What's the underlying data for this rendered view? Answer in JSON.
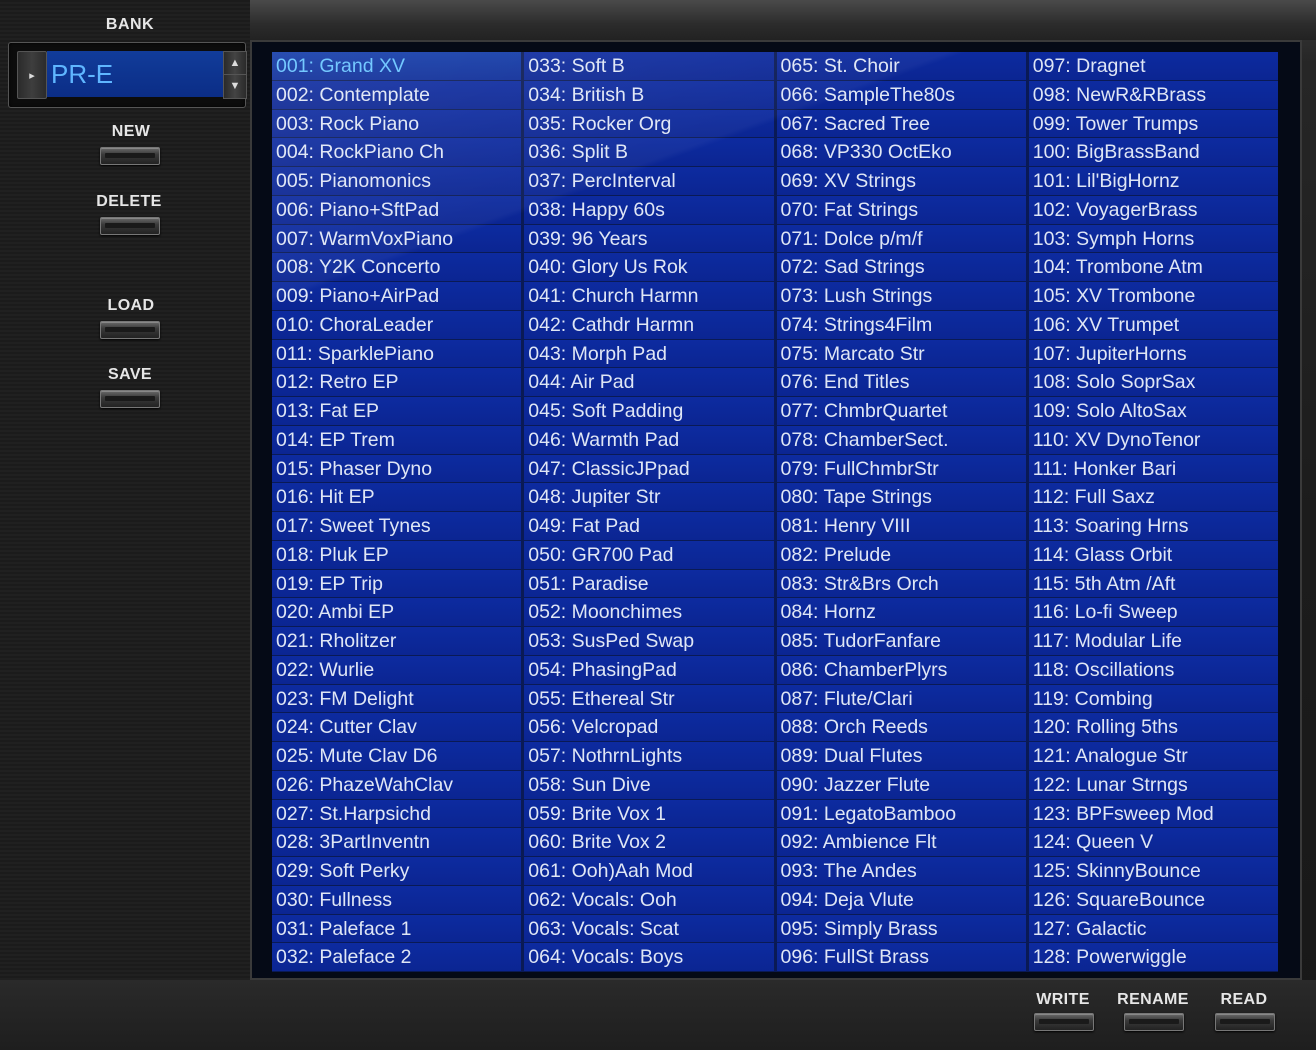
{
  "bank": {
    "label": "BANK",
    "value": "PR-E",
    "arrow_icon": "play-arrow-icon",
    "spin_up_icon": "triangle-up-icon",
    "spin_down_icon": "triangle-down-icon"
  },
  "side_buttons": {
    "new_label": "NEW",
    "delete_label": "DELETE",
    "load_label": "LOAD",
    "save_label": "SAVE"
  },
  "bottom_buttons": {
    "write_label": "WRITE",
    "rename_label": "RENAME",
    "read_label": "READ"
  },
  "colors": {
    "cell_bg": "#0b2592",
    "selected_text": "#66c3ff",
    "text": "#dfe6f5"
  },
  "patch_list": {
    "selected_index": 0,
    "columns": [
      [
        "001: Grand XV",
        "002: Contemplate",
        "003: Rock Piano",
        "004: RockPiano Ch",
        "005: Pianomonics",
        "006: Piano+SftPad",
        "007: WarmVoxPiano",
        "008: Y2K Concerto",
        "009: Piano+AirPad",
        "010: ChoraLeader",
        "011: SparklePiano",
        "012: Retro EP",
        "013: Fat EP",
        "014: EP Trem",
        "015: Phaser Dyno",
        "016: Hit EP",
        "017: Sweet Tynes",
        "018: Pluk EP",
        "019: EP Trip",
        "020: Ambi EP",
        "021: Rholitzer",
        "022: Wurlie",
        "023: FM Delight",
        "024: Cutter Clav",
        "025: Mute Clav D6",
        "026: PhazeWahClav",
        "027: St.Harpsichd",
        "028: 3PartInventn",
        "029: Soft Perky",
        "030: Fullness",
        "031: Paleface 1",
        "032: Paleface 2"
      ],
      [
        "033: Soft B",
        "034: British B",
        "035: Rocker Org",
        "036: Split B",
        "037: PercInterval",
        "038: Happy 60s",
        "039: 96 Years",
        "040: Glory Us Rok",
        "041: Church Harmn",
        "042: Cathdr Harmn",
        "043: Morph Pad",
        "044: Air Pad",
        "045: Soft Padding",
        "046: Warmth Pad",
        "047: ClassicJPpad",
        "048: Jupiter Str",
        "049: Fat Pad",
        "050: GR700 Pad",
        "051: Paradise",
        "052: Moonchimes",
        "053: SusPed Swap",
        "054: PhasingPad",
        "055: Ethereal Str",
        "056: Velcropad",
        "057: NothrnLights",
        "058: Sun Dive",
        "059: Brite Vox 1",
        "060: Brite Vox 2",
        "061: Ooh)Aah Mod",
        "062: Vocals: Ooh",
        "063: Vocals: Scat",
        "064: Vocals: Boys"
      ],
      [
        "065: St. Choir",
        "066: SampleThe80s",
        "067: Sacred Tree",
        "068: VP330 OctEko",
        "069: XV Strings",
        "070: Fat Strings",
        "071: Dolce  p/m/f",
        "072: Sad Strings",
        "073: Lush Strings",
        "074: Strings4Film",
        "075: Marcato Str",
        "076: End Titles",
        "077: ChmbrQuartet",
        "078: ChamberSect.",
        "079: FullChmbrStr",
        "080: Tape Strings",
        "081: Henry VIII",
        "082: Prelude",
        "083: Str&Brs Orch",
        "084: Hornz",
        "085: TudorFanfare",
        "086: ChamberPlyrs",
        "087: Flute/Clari",
        "088: Orch Reeds",
        "089: Dual Flutes",
        "090: Jazzer Flute",
        "091: LegatoBamboo",
        "092: Ambience Flt",
        "093: The Andes",
        "094: Deja Vlute",
        "095: Simply Brass",
        "096: FullSt Brass"
      ],
      [
        "097: Dragnet",
        "098: NewR&RBrass",
        "099: Tower Trumps",
        "100: BigBrassBand",
        "101: Lil'BigHornz",
        "102: VoyagerBrass",
        "103: Symph Horns",
        "104: Trombone Atm",
        "105: XV Trombone",
        "106: XV Trumpet",
        "107: JupiterHorns",
        "108: Solo SoprSax",
        "109: Solo AltoSax",
        "110: XV DynoTenor",
        "111: Honker Bari",
        "112: Full Saxz",
        "113: Soaring Hrns",
        "114: Glass Orbit",
        "115: 5th Atm /Aft",
        "116: Lo-fi Sweep",
        "117: Modular Life",
        "118: Oscillations",
        "119: Combing",
        "120: Rolling 5ths",
        "121: Analogue Str",
        "122: Lunar Strngs",
        "123: BPFsweep Mod",
        "124: Queen V",
        "125: SkinnyBounce",
        "126: SquareBounce",
        "127: Galactic",
        "128: Powerwiggle"
      ]
    ]
  }
}
